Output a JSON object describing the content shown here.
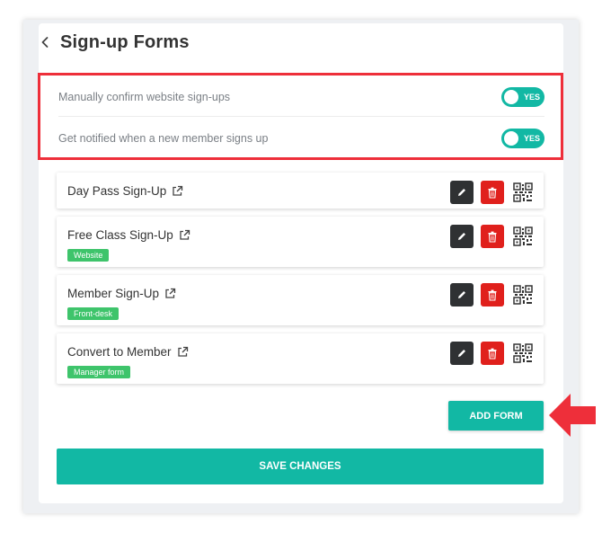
{
  "header": {
    "title": "Sign-up Forms",
    "back_icon": "chevron-left-icon"
  },
  "settings": [
    {
      "label": "Manually confirm website sign-ups",
      "toggle_label": "YES",
      "enabled": true
    },
    {
      "label": "Get notified when a new member signs up",
      "toggle_label": "YES",
      "enabled": true
    }
  ],
  "forms": [
    {
      "name": "Day Pass Sign-Up",
      "tag": ""
    },
    {
      "name": "Free Class Sign-Up",
      "tag": "Website"
    },
    {
      "name": "Member Sign-Up",
      "tag": "Front-desk"
    },
    {
      "name": "Convert to Member",
      "tag": "Manager form"
    }
  ],
  "icons": {
    "external": "external-link-icon",
    "edit": "pencil-icon",
    "delete": "trash-icon",
    "qr": "qr-code-icon"
  },
  "buttons": {
    "add_form": "ADD FORM",
    "save_changes": "SAVE CHANGES"
  },
  "colors": {
    "accent": "#12b8a4",
    "highlight_border": "#ee2f3a",
    "delete": "#e0201c",
    "edit": "#2f3133",
    "tag": "#3ec46b"
  }
}
